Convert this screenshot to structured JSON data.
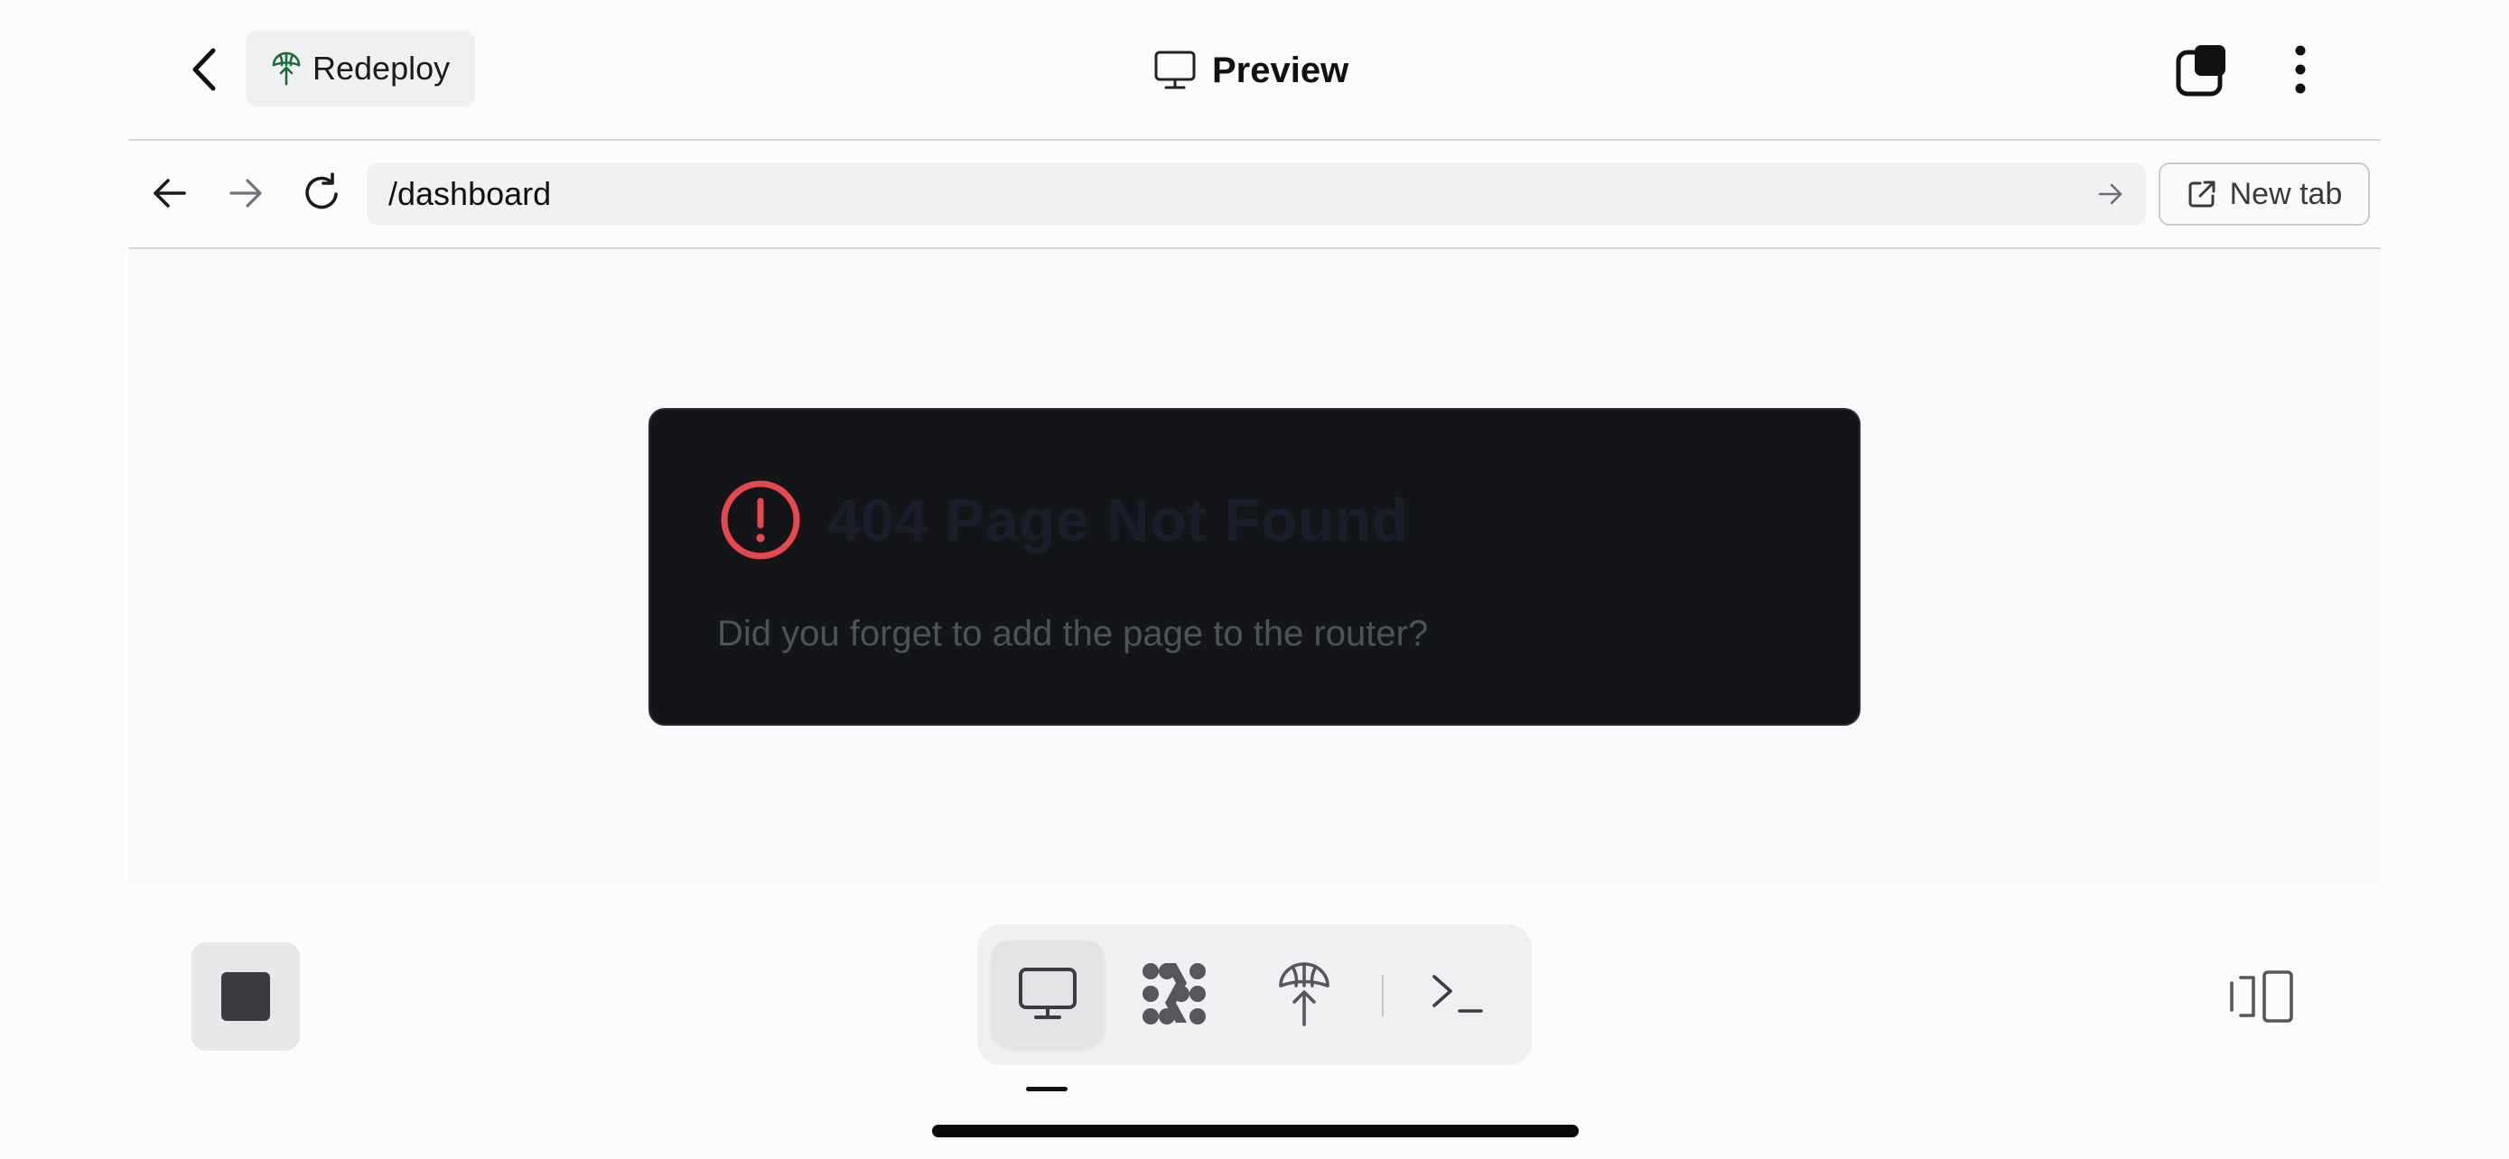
{
  "header": {
    "redeploy_label": "Redeploy",
    "title": "Preview",
    "icons": {
      "back": "chevron-left-icon",
      "redeploy": "redeploy-icon",
      "title": "monitor-icon",
      "tabs": "tabs-icon",
      "more": "more-vertical-icon"
    }
  },
  "address_bar": {
    "url": "/dashboard",
    "new_tab_label": "New tab",
    "icons": {
      "back": "arrow-left-icon",
      "forward": "arrow-right-icon",
      "reload": "reload-icon",
      "go": "go-arrow-icon",
      "new_tab": "external-link-icon"
    }
  },
  "content": {
    "error_title": "404 Page Not Found",
    "error_message": "Did you forget to add the page to the router?",
    "error_icon": "alert-circle-icon"
  },
  "toolbar": {
    "stop_icon": "stop-icon",
    "tools": [
      {
        "name": "desktop-icon",
        "active": true
      },
      {
        "name": "workflows-icon",
        "active": false
      },
      {
        "name": "deploy-icon",
        "active": false
      },
      {
        "name": "terminal-icon",
        "active": false
      }
    ],
    "panel_toggle_icon": "panel-toggle-icon"
  },
  "colors": {
    "error_red": "#e5484d",
    "card_bg": "#141519",
    "redeploy_green": "#1d6b3a"
  }
}
